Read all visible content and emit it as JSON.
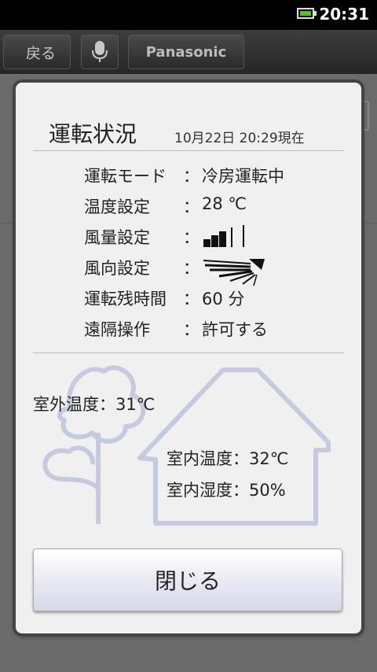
{
  "status_bar": {
    "time": "20:31",
    "battery_icon": "battery-charging-icon"
  },
  "toolbar": {
    "back_label": "戻る",
    "mic_icon": "microphone-icon",
    "brand_label": "Panasonic"
  },
  "dialog": {
    "title": "運転状況",
    "timestamp": "10月22日 20:29現在",
    "rows": [
      {
        "label": "運転モード",
        "colon": "：",
        "value": "冷房運転中"
      },
      {
        "label": "温度設定",
        "colon": "：",
        "value": "28 ℃"
      },
      {
        "label": "風量設定",
        "colon": "：",
        "value": "",
        "icon": "fan-speed-icon"
      },
      {
        "label": "風向設定",
        "colon": "：",
        "value": "",
        "icon": "airflow-direction-icon"
      },
      {
        "label": "運転残時間",
        "colon": "：",
        "value": "60 分"
      },
      {
        "label": "遠隔操作",
        "colon": "：",
        "value": "許可する"
      }
    ],
    "outdoor_temp": "室外温度：31℃",
    "indoor_temp": "室内温度：32℃",
    "indoor_humidity": "室内湿度：50%",
    "close_label": "閉じる"
  },
  "colors": {
    "illustration": "#c5cadf",
    "dialog_bg": "#f0f0f0",
    "battery_green": "#5bbd2b"
  }
}
